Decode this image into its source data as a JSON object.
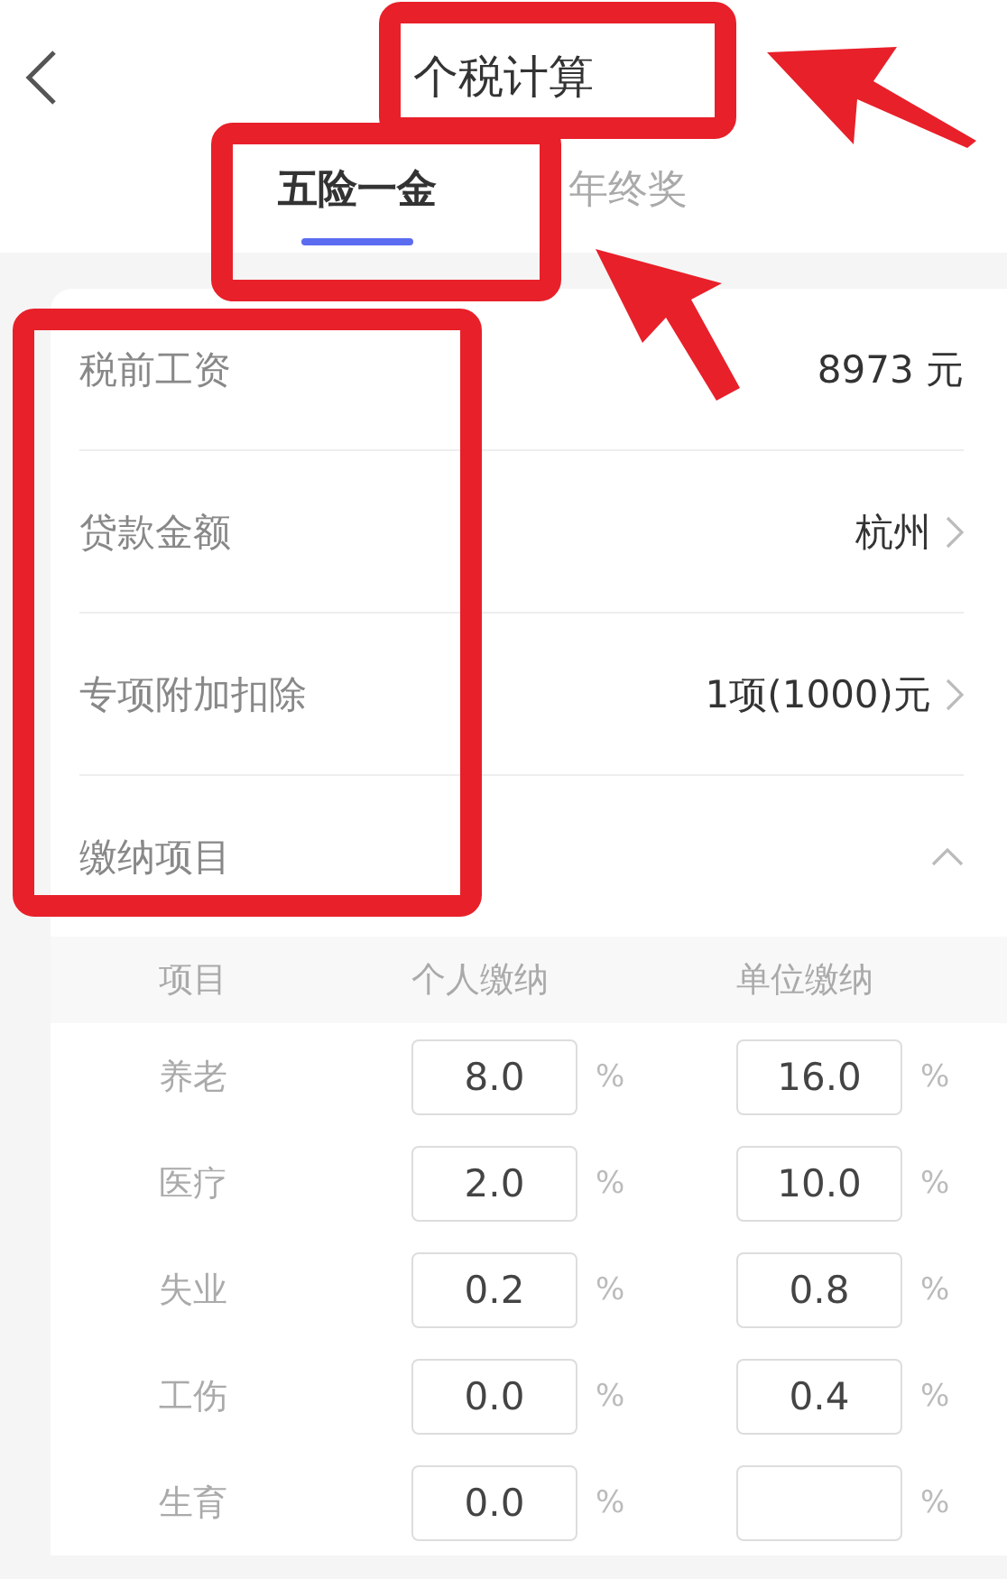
{
  "header": {
    "title": "个税计算"
  },
  "tabs": [
    {
      "label": "五险一金",
      "selected": true
    },
    {
      "label": "年终奖",
      "selected": false
    }
  ],
  "fields": [
    {
      "kind": "value",
      "label": "税前工资",
      "value": "8973 元"
    },
    {
      "kind": "link",
      "label": "贷款金额",
      "value": "杭州"
    },
    {
      "kind": "link",
      "label": "专项附加扣除",
      "value": "1项(1000)元"
    },
    {
      "kind": "section",
      "label": "缴纳项目",
      "expanded": true
    }
  ],
  "table": {
    "columns": [
      "项目",
      "个人缴纳",
      "单位缴纳"
    ],
    "rows": [
      {
        "item": "养老",
        "personal": {
          "value": "8.0",
          "unit": "%"
        },
        "company": {
          "value": "16.0",
          "unit": "%"
        }
      },
      {
        "item": "医疗",
        "personal": {
          "value": "2.0",
          "unit": "%"
        },
        "company": {
          "value": "10.0",
          "unit": "%"
        }
      },
      {
        "item": "失业",
        "personal": {
          "value": "0.2",
          "unit": "%"
        },
        "company": {
          "value": "0.8",
          "unit": "%"
        }
      },
      {
        "item": "工伤",
        "personal": {
          "value": "0.0",
          "unit": "%"
        },
        "company": {
          "value": "0.4",
          "unit": "%"
        }
      },
      {
        "item": "生育",
        "personal": {
          "value": "0.0",
          "unit": "%"
        },
        "company": {
          "unit": "%"
        }
      }
    ]
  }
}
